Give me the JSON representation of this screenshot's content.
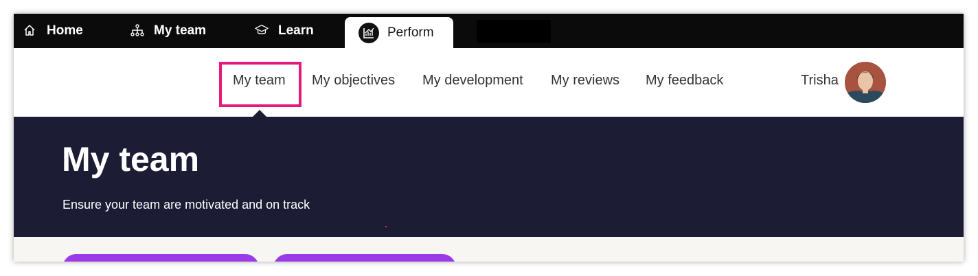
{
  "topnav": {
    "tabs": [
      {
        "label": "Home",
        "icon": "home-icon"
      },
      {
        "label": "My team",
        "icon": "org-chart-icon"
      },
      {
        "label": "Learn",
        "icon": "graduation-cap-icon"
      },
      {
        "label": "Perform",
        "icon": "chart-icon",
        "active": true
      }
    ]
  },
  "subnav": {
    "items": [
      {
        "label": "My team",
        "selected": true
      },
      {
        "label": "My objectives"
      },
      {
        "label": "My development"
      },
      {
        "label": "My reviews"
      },
      {
        "label": "My feedback"
      }
    ],
    "user_name": "Trisha"
  },
  "hero": {
    "title": "My team",
    "subtitle": "Ensure your team are motivated and on track"
  },
  "colors": {
    "topbar": "#0b0b0c",
    "hero": "#1c1c35",
    "highlight": "#e6197b",
    "pill": "#9b3be8"
  }
}
